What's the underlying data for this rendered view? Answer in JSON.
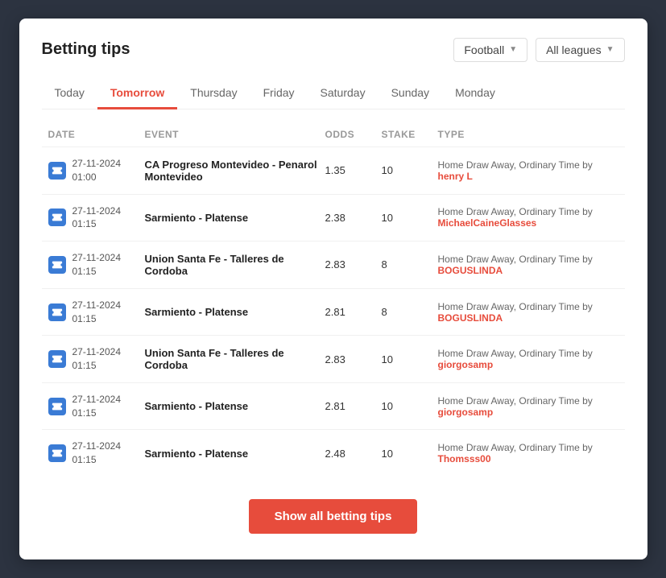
{
  "header": {
    "title": "Betting tips",
    "filter_football": "Football",
    "filter_leagues": "All leagues"
  },
  "tabs": [
    {
      "label": "Today",
      "active": false
    },
    {
      "label": "Tomorrow",
      "active": true
    },
    {
      "label": "Thursday",
      "active": false
    },
    {
      "label": "Friday",
      "active": false
    },
    {
      "label": "Saturday",
      "active": false
    },
    {
      "label": "Sunday",
      "active": false
    },
    {
      "label": "Monday",
      "active": false
    }
  ],
  "table": {
    "columns": [
      "DATE",
      "EVENT",
      "ODDS",
      "STAKE",
      "TYPE"
    ],
    "rows": [
      {
        "date": "27-11-2024",
        "time": "01:00",
        "event": "CA Progreso Montevideo - Penarol Montevideo",
        "odds": "1.35",
        "stake": "10",
        "type_text": "Home Draw Away, Ordinary Time by ",
        "user": "henry L",
        "user_color": "#e74c3c"
      },
      {
        "date": "27-11-2024",
        "time": "01:15",
        "event": "Sarmiento - Platense",
        "odds": "2.38",
        "stake": "10",
        "type_text": "Home Draw Away, Ordinary Time by ",
        "user": "MichaelCaineGlasses",
        "user_color": "#e74c3c"
      },
      {
        "date": "27-11-2024",
        "time": "01:15",
        "event": "Union Santa Fe - Talleres de Cordoba",
        "odds": "2.83",
        "stake": "8",
        "type_text": "Home Draw Away, Ordinary Time by ",
        "user": "BOGUSLINDA",
        "user_color": "#e74c3c"
      },
      {
        "date": "27-11-2024",
        "time": "01:15",
        "event": "Sarmiento - Platense",
        "odds": "2.81",
        "stake": "8",
        "type_text": "Home Draw Away, Ordinary Time by ",
        "user": "BOGUSLINDA",
        "user_color": "#e74c3c"
      },
      {
        "date": "27-11-2024",
        "time": "01:15",
        "event": "Union Santa Fe - Talleres de Cordoba",
        "odds": "2.83",
        "stake": "10",
        "type_text": "Home Draw Away, Ordinary Time by ",
        "user": "giorgosamp",
        "user_color": "#e74c3c"
      },
      {
        "date": "27-11-2024",
        "time": "01:15",
        "event": "Sarmiento - Platense",
        "odds": "2.81",
        "stake": "10",
        "type_text": "Home Draw Away, Ordinary Time by ",
        "user": "giorgosamp",
        "user_color": "#e74c3c"
      },
      {
        "date": "27-11-2024",
        "time": "01:15",
        "event": "Sarmiento - Platense",
        "odds": "2.48",
        "stake": "10",
        "type_text": "Home Draw Away, Ordinary Time by ",
        "user": "Thomsss00",
        "user_color": "#e74c3c"
      }
    ]
  },
  "show_button": "Show all betting tips"
}
